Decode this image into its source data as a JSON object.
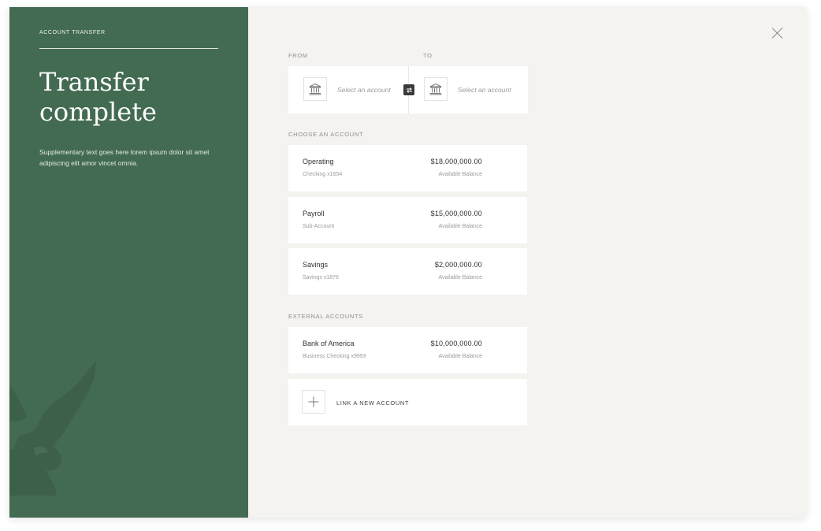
{
  "left_panel": {
    "eyebrow": "ACCOUNT TRANSFER",
    "title": "Transfer complete",
    "description": "Supplementary text goes here lorem ipsum dolor sit amet adipiscing elit amor vincet omnia.",
    "bg_color": "#436b52"
  },
  "transfer": {
    "from_label": "FROM",
    "to_label": "TO",
    "from_placeholder": "Select an account",
    "to_placeholder": "Select an account"
  },
  "choose": {
    "heading": "CHOOSE AN ACCOUNT",
    "accounts": [
      {
        "name": "Operating",
        "sub": "Checking x1654",
        "amount": "$18,000,000.00",
        "balance_label": "Available Balance"
      },
      {
        "name": "Payroll",
        "sub": "Sub-Account",
        "amount": "$15,000,000.00",
        "balance_label": "Available Balance"
      },
      {
        "name": "Savings",
        "sub": "Savings x1876",
        "amount": "$2,000,000.00",
        "balance_label": "Available Balance"
      }
    ]
  },
  "external": {
    "heading": "EXTERNAL ACCOUNTS",
    "accounts": [
      {
        "name": "Bank of America",
        "sub": "Business Checking x9993",
        "amount": "$10,000,000.00",
        "balance_label": "Available Balance"
      }
    ],
    "link_label": "LINK A NEW ACCOUNT"
  },
  "icons": {
    "close": "close-icon",
    "bank": "bank-icon",
    "swap": "swap-icon",
    "plus": "plus-icon",
    "eagle": "eagle-icon"
  }
}
